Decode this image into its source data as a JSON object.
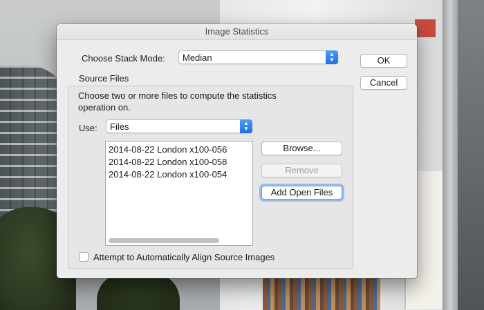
{
  "dialog": {
    "title": "Image Statistics"
  },
  "stack_mode": {
    "label": "Choose Stack Mode:",
    "value": "Median"
  },
  "buttons": {
    "ok": "OK",
    "cancel": "Cancel",
    "browse": "Browse...",
    "remove": "Remove",
    "add_open_files": "Add Open Files"
  },
  "source_files": {
    "title": "Source Files",
    "description_line1": "Choose two or more files to compute the statistics",
    "description_line2": "operation on.",
    "use_label": "Use:",
    "use_value": "Files",
    "files": [
      "2014-08-22 London x100-056",
      "2014-08-22 London x100-058",
      "2014-08-22 London x100-054"
    ]
  },
  "align": {
    "label": "Attempt to Automatically Align Source Images",
    "checked": false
  },
  "colors": {
    "accent": "#2a7ae8",
    "dialog_bg": "#ececec"
  }
}
